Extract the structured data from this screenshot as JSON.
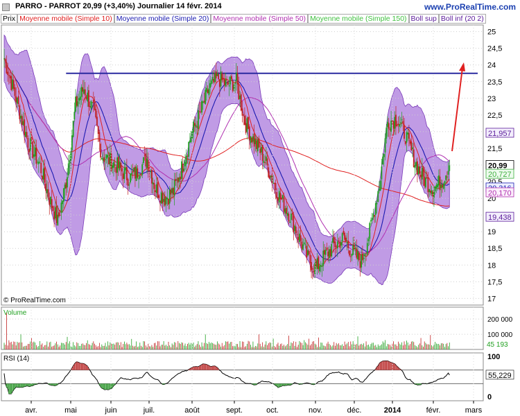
{
  "header": {
    "title": "PARRO - PARROT     20,99 (+3,40%)    Journalier  14 févr. 2014",
    "brand": "www.ProRealTime.com",
    "copyright": "© ProRealTime.com"
  },
  "legend": [
    {
      "label": "Prix",
      "color": "#000000"
    },
    {
      "label": "Moyenne mobile (Simple 10)",
      "color": "#e02020"
    },
    {
      "label": "Moyenne mobile (Simple 20)",
      "color": "#1a1ab0"
    },
    {
      "label": "Moyenne mobile (Simple 50)",
      "color": "#b030b0"
    },
    {
      "label": "Moyenne mobile (Simple 150)",
      "color": "#40c040"
    },
    {
      "label": "Boll sup",
      "color": "#5a1a9a"
    },
    {
      "label": "Boll inf (20 2)",
      "color": "#5a1a9a"
    }
  ],
  "colors": {
    "band_fill": "#b58ae0",
    "band_edge": "#7a3ab8",
    "up_candle": "#20a020",
    "down_candle": "#c02020",
    "resistance_line": "#2a2aa0",
    "arrow": "#e02020"
  },
  "price_labels": {
    "boll_sup": "21,957",
    "close": "20,99",
    "ma150": "20,727",
    "ma20": "20,316",
    "ma50": "20,170",
    "boll_inf": "19,438"
  },
  "volume_panel": {
    "label": "Volume",
    "ticks": [
      "200 000",
      "100 000"
    ],
    "last": "45 193"
  },
  "rsi_panel": {
    "label": "RSI (14)",
    "ticks": [
      "100",
      "0"
    ],
    "last": "55,229"
  },
  "chart_data": {
    "type": "candlestick",
    "title": "PARRO - PARROT",
    "ylim": [
      16.8,
      25.2
    ],
    "y_ticks": [
      25,
      24.5,
      24,
      23.5,
      23,
      22.5,
      22,
      21.5,
      21,
      20.5,
      20,
      19.5,
      19,
      18.5,
      18,
      17.5,
      17
    ],
    "y_tick_labels": [
      "25",
      "24,5",
      "24",
      "23,5",
      "23",
      "22,5",
      "22",
      "21,5",
      "21",
      "20,5",
      "20",
      "19,5",
      "19",
      "18,5",
      "18",
      "17,5",
      "17"
    ],
    "x_tick_labels": [
      "avr.",
      "mai",
      "juin",
      "juil.",
      "août",
      "sept.",
      "oct.",
      "nov.",
      "déc.",
      "2014",
      "févr.",
      "mars"
    ],
    "resistance_level": 23.75,
    "series": [
      {
        "name": "Moyenne mobile (Simple 10)",
        "last": 20.5
      },
      {
        "name": "Moyenne mobile (Simple 20)",
        "last": 20.316
      },
      {
        "name": "Moyenne mobile (Simple 50)",
        "last": 20.17
      },
      {
        "name": "Moyenne mobile (Simple 150)",
        "last": 20.727
      },
      {
        "name": "Boll sup",
        "last": 21.957
      },
      {
        "name": "Boll inf (20 2)",
        "last": 19.438
      }
    ],
    "close_anchors": [
      [
        0,
        24.2
      ],
      [
        10,
        23.0
      ],
      [
        20,
        21.7
      ],
      [
        30,
        21.0
      ],
      [
        38,
        20.0
      ],
      [
        45,
        19.3
      ],
      [
        52,
        20.5
      ],
      [
        60,
        22.8
      ],
      [
        67,
        23.3
      ],
      [
        75,
        22.6
      ],
      [
        82,
        21.3
      ],
      [
        90,
        21.1
      ],
      [
        97,
        20.9
      ],
      [
        105,
        20.6
      ],
      [
        112,
        20.8
      ],
      [
        120,
        21.2
      ],
      [
        127,
        20.3
      ],
      [
        135,
        20.0
      ],
      [
        142,
        20.2
      ],
      [
        150,
        21.0
      ],
      [
        157,
        21.9
      ],
      [
        165,
        22.6
      ],
      [
        172,
        23.3
      ],
      [
        180,
        23.6
      ],
      [
        187,
        23.4
      ],
      [
        195,
        23.5
      ],
      [
        202,
        22.3
      ],
      [
        210,
        21.7
      ],
      [
        217,
        21.3
      ],
      [
        225,
        20.6
      ],
      [
        232,
        20.0
      ],
      [
        240,
        19.5
      ],
      [
        247,
        18.9
      ],
      [
        255,
        18.2
      ],
      [
        262,
        17.9
      ],
      [
        270,
        18.3
      ],
      [
        277,
        18.6
      ],
      [
        285,
        18.8
      ],
      [
        292,
        18.4
      ],
      [
        300,
        18.1
      ],
      [
        307,
        19.0
      ],
      [
        315,
        20.4
      ],
      [
        322,
        22.3
      ],
      [
        330,
        22.4
      ],
      [
        337,
        21.9
      ],
      [
        345,
        21.1
      ],
      [
        352,
        20.6
      ],
      [
        360,
        20.3
      ],
      [
        367,
        20.5
      ],
      [
        374,
        20.99
      ]
    ],
    "volume": {
      "max": 200000,
      "last": 45193
    },
    "rsi": {
      "levels": [
        30,
        70
      ],
      "last": 55.229
    }
  }
}
